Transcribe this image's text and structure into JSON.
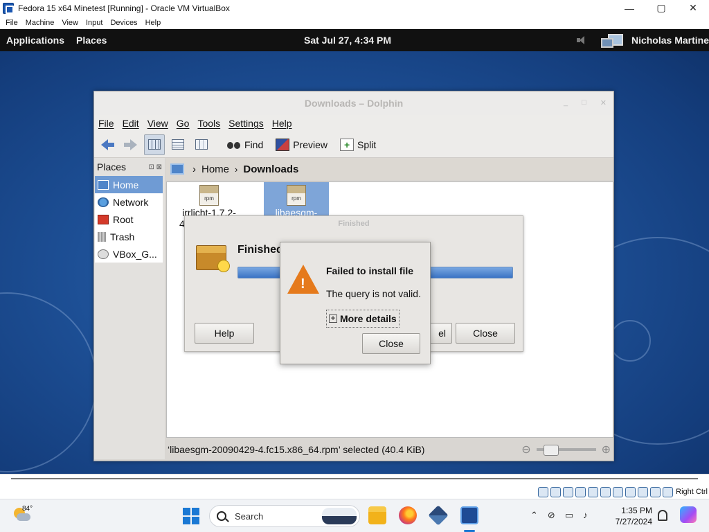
{
  "vbox": {
    "title": "Fedora 15 x64 Minetest [Running] - Oracle VM VirtualBox",
    "window_controls": [
      "—",
      "▢",
      "✕"
    ],
    "menu": [
      "File",
      "Machine",
      "View",
      "Input",
      "Devices",
      "Help"
    ],
    "host_key": "Right Ctrl"
  },
  "gnome_panel": {
    "applications": "Applications",
    "places": "Places",
    "clock": "Sat Jul 27,  4:34 PM",
    "user": "Nicholas Martine"
  },
  "dolphin": {
    "title": "Downloads – Dolphin",
    "menu": [
      "File",
      "Edit",
      "View",
      "Go",
      "Tools",
      "Settings",
      "Help"
    ],
    "toolbar": {
      "find": "Find",
      "preview": "Preview",
      "split": "Split"
    },
    "places_title": "Places",
    "places": [
      {
        "label": "Home",
        "icon": "home-icon"
      },
      {
        "label": "Network",
        "icon": "network-icon"
      },
      {
        "label": "Root",
        "icon": "root-folder-icon"
      },
      {
        "label": "Trash",
        "icon": "trash-icon"
      },
      {
        "label": "VBox_G...",
        "icon": "drive-icon"
      }
    ],
    "breadcrumb": {
      "home": "Home",
      "current": "Downloads",
      "separator": "›"
    },
    "files": [
      {
        "name": "irrlicht-1.7.2-4",
        "icon": "rpm",
        "line1": "irrlicht-1.7.2-",
        "line2": "4"
      },
      {
        "name": "libaesgm-",
        "icon": "rpm",
        "line1": "libaesgm-"
      }
    ],
    "status": "‘libaesgm-20090429-4.fc15.x86_64.rpm’ selected (40.4 KiB)"
  },
  "finished_dialog": {
    "title": "Finished",
    "heading": "Finished",
    "progress_percent": 100,
    "help": "Help",
    "cancel_fragment": "el",
    "close": "Close"
  },
  "error_dialog": {
    "title": "Failed to install file",
    "message": "The query is not valid.",
    "more_details": "More details",
    "close": "Close"
  },
  "taskbar": {
    "temperature": "84°",
    "search_placeholder": "Search",
    "time": "1:35 PM",
    "date": "7/27/2024"
  }
}
